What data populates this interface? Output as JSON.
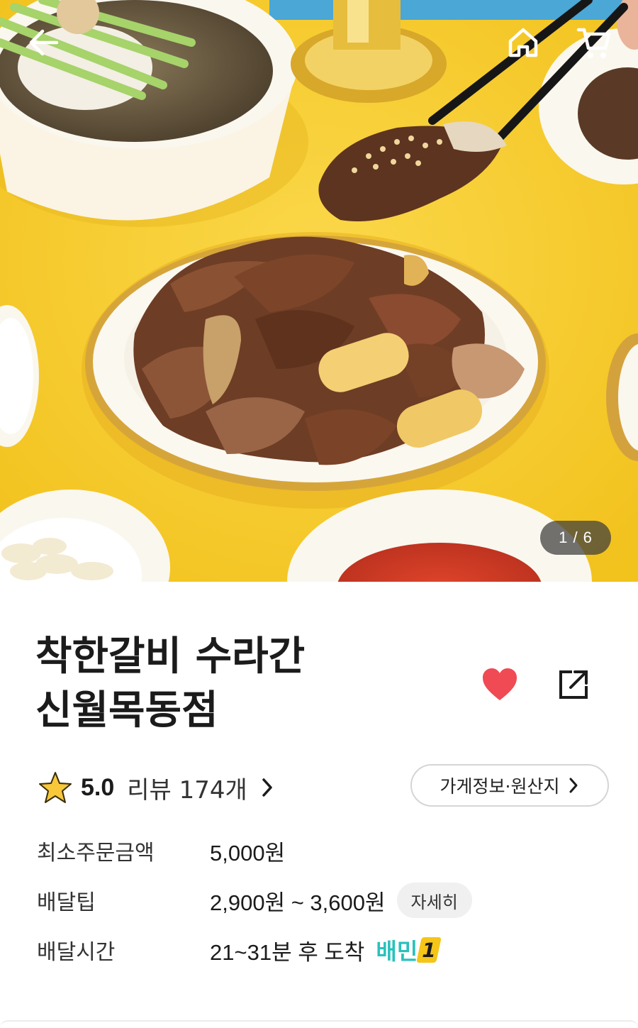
{
  "hero": {
    "image_desc": "galbi",
    "page_current": "1",
    "page_total": "6",
    "page_separator": " / "
  },
  "header": {
    "back_icon": "arrow-left-icon",
    "home_icon": "home-icon",
    "cart_icon": "cart-icon"
  },
  "store": {
    "name_line1": "착한갈비 수라간",
    "name_line2": "신월목동점",
    "favorite_icon": "heart-icon",
    "share_icon": "share-icon",
    "favorite_color": "#f04a54"
  },
  "rating": {
    "star_icon": "star-icon",
    "value": "5.0",
    "review_text": "리뷰 174개"
  },
  "info_button": {
    "label": "가게정보·원산지"
  },
  "details": {
    "min_order_label": "최소주문금액",
    "min_order_value": "5,000원",
    "delivery_tip_label": "배달팁",
    "delivery_tip_value": "2,900원 ~ 3,600원",
    "delivery_tip_detail": "자세히",
    "delivery_time_label": "배달시간",
    "delivery_time_value": "21~31분 후 도착",
    "baemin_label": "배민",
    "baemin_number": "1",
    "baemin_color": "#2ac1bc"
  }
}
